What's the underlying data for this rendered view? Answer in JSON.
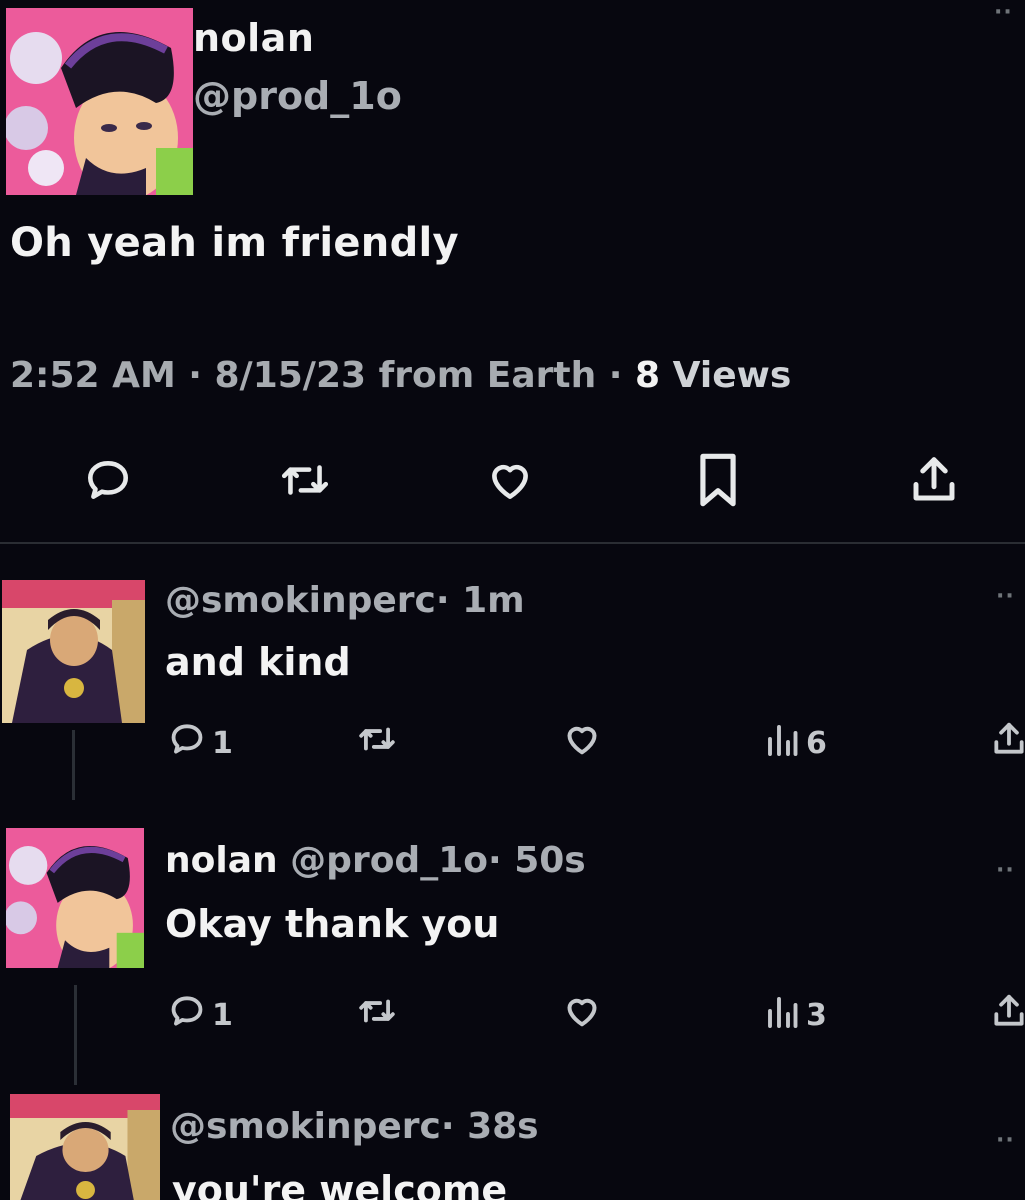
{
  "post": {
    "author_name": "nolan",
    "author_handle": "@prod_1o",
    "text_part1": "Oh yeah im",
    "text_part2": "friendly",
    "meta_time": "2:52 AM · 8/15/23 from Earth ·",
    "meta_views_count": "8",
    "meta_views_label": "Views",
    "actions": [
      "reply-icon",
      "retweet-icon",
      "like-icon",
      "bookmark-icon",
      "share-icon"
    ]
  },
  "replies": [
    {
      "name": "",
      "handle": "@smokinperc",
      "time": "· 1m",
      "text": "and kind",
      "reply_count": "1",
      "view_count": "6",
      "avatar": "okuyasu-avatar"
    },
    {
      "name": "nolan",
      "handle": "@prod_1o",
      "time": "· 50s",
      "text": "Okay thank you",
      "reply_count": "1",
      "view_count": "3",
      "avatar": "josuke-avatar"
    },
    {
      "name": "",
      "handle": "@smokinperc",
      "time": "· 38s",
      "text": "you're welcome",
      "avatar": "okuyasu-avatar"
    }
  ],
  "more_label": "··"
}
